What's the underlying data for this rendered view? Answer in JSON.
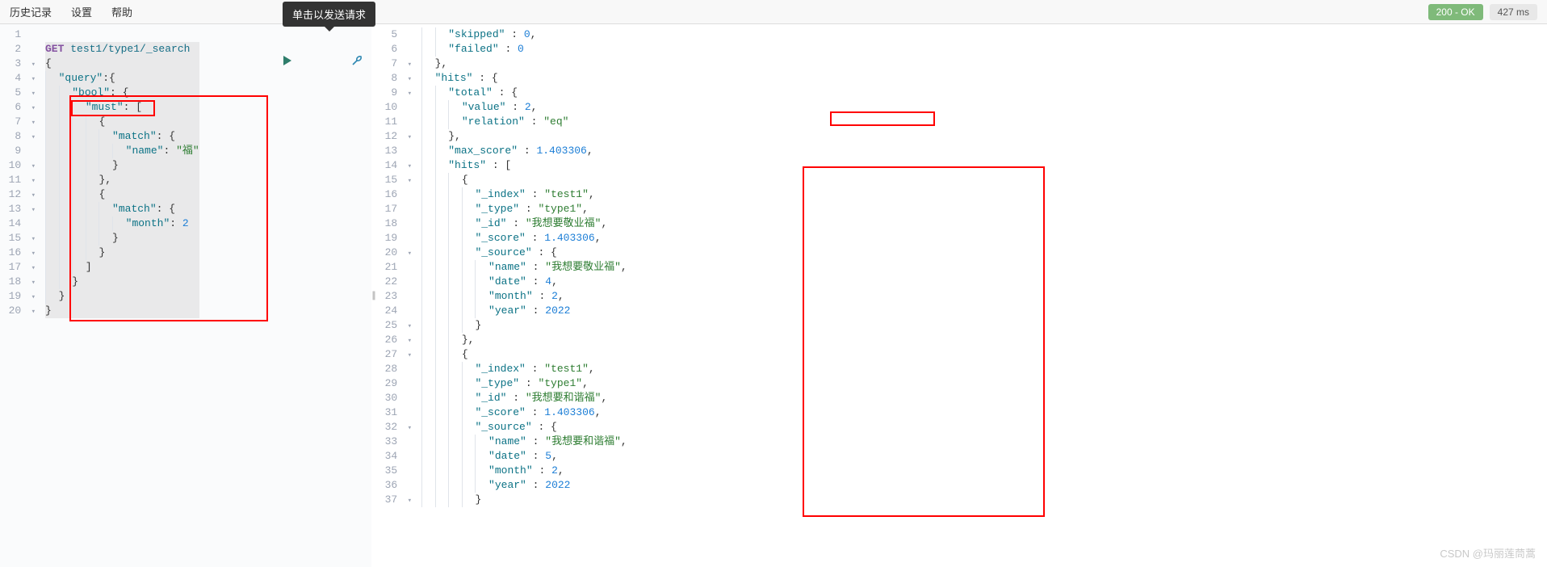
{
  "menu": {
    "history": "历史记录",
    "settings": "设置",
    "help": "帮助"
  },
  "tooltip": "单击以发送请求",
  "status": {
    "ok": "200 - OK",
    "time": "427 ms"
  },
  "request": {
    "method": "GET",
    "path": "test1/type1/_search",
    "lines": [
      {
        "n": 1,
        "t": ""
      },
      {
        "n": 2,
        "t": "__METHOD__ __PATH__"
      },
      {
        "n": 3,
        "t": "{",
        "fold": true
      },
      {
        "n": 4,
        "t": "  \"query\":{",
        "fold": true
      },
      {
        "n": 5,
        "t": "    \"bool\": {",
        "fold": true
      },
      {
        "n": 6,
        "t": "      \"must\": [",
        "fold": true
      },
      {
        "n": 7,
        "t": "        {",
        "fold": true
      },
      {
        "n": 8,
        "t": "          \"match\": {",
        "fold": true
      },
      {
        "n": 9,
        "t": "            \"name\": \"福\""
      },
      {
        "n": 10,
        "t": "          }",
        "fold": true
      },
      {
        "n": 11,
        "t": "        },",
        "fold": true
      },
      {
        "n": 12,
        "t": "        {",
        "fold": true
      },
      {
        "n": 13,
        "t": "          \"match\": {",
        "fold": true
      },
      {
        "n": 14,
        "t": "            \"month\": 2",
        "active": true
      },
      {
        "n": 15,
        "t": "          }",
        "fold": true
      },
      {
        "n": 16,
        "t": "        }",
        "fold": true
      },
      {
        "n": 17,
        "t": "      ]",
        "fold": true
      },
      {
        "n": 18,
        "t": "    }",
        "fold": true
      },
      {
        "n": 19,
        "t": "  }",
        "fold": true
      },
      {
        "n": 20,
        "t": "}",
        "fold": true
      }
    ]
  },
  "response": {
    "start": 5,
    "lines": [
      {
        "n": 5,
        "t": "    \"skipped\" : 0,"
      },
      {
        "n": 6,
        "t": "    \"failed\" : 0"
      },
      {
        "n": 7,
        "t": "  },",
        "fold": true
      },
      {
        "n": 8,
        "t": "  \"hits\" : {",
        "fold": true
      },
      {
        "n": 9,
        "t": "    \"total\" : {",
        "fold": true
      },
      {
        "n": 10,
        "t": "      \"value\" : 2,"
      },
      {
        "n": 11,
        "t": "      \"relation\" : \"eq\""
      },
      {
        "n": 12,
        "t": "    },",
        "fold": true
      },
      {
        "n": 13,
        "t": "    \"max_score\" : 1.403306,"
      },
      {
        "n": 14,
        "t": "    \"hits\" : [",
        "fold": true
      },
      {
        "n": 15,
        "t": "      {",
        "fold": true
      },
      {
        "n": 16,
        "t": "        \"_index\" : \"test1\","
      },
      {
        "n": 17,
        "t": "        \"_type\" : \"type1\","
      },
      {
        "n": 18,
        "t": "        \"_id\" : \"我想要敬业福\","
      },
      {
        "n": 19,
        "t": "        \"_score\" : 1.403306,"
      },
      {
        "n": 20,
        "t": "        \"_source\" : {",
        "fold": true
      },
      {
        "n": 21,
        "t": "          \"name\" : \"我想要敬业福\","
      },
      {
        "n": 22,
        "t": "          \"date\" : 4,"
      },
      {
        "n": 23,
        "t": "          \"month\" : 2,"
      },
      {
        "n": 24,
        "t": "          \"year\" : 2022"
      },
      {
        "n": 25,
        "t": "        }",
        "fold": true
      },
      {
        "n": 26,
        "t": "      },",
        "fold": true
      },
      {
        "n": 27,
        "t": "      {",
        "fold": true
      },
      {
        "n": 28,
        "t": "        \"_index\" : \"test1\","
      },
      {
        "n": 29,
        "t": "        \"_type\" : \"type1\","
      },
      {
        "n": 30,
        "t": "        \"_id\" : \"我想要和谐福\","
      },
      {
        "n": 31,
        "t": "        \"_score\" : 1.403306,"
      },
      {
        "n": 32,
        "t": "        \"_source\" : {",
        "fold": true
      },
      {
        "n": 33,
        "t": "          \"name\" : \"我想要和谐福\","
      },
      {
        "n": 34,
        "t": "          \"date\" : 5,"
      },
      {
        "n": 35,
        "t": "          \"month\" : 2,"
      },
      {
        "n": 36,
        "t": "          \"year\" : 2022"
      },
      {
        "n": 37,
        "t": "        }",
        "fold": true
      }
    ]
  },
  "watermark": "CSDN @玛丽莲茼蒿"
}
